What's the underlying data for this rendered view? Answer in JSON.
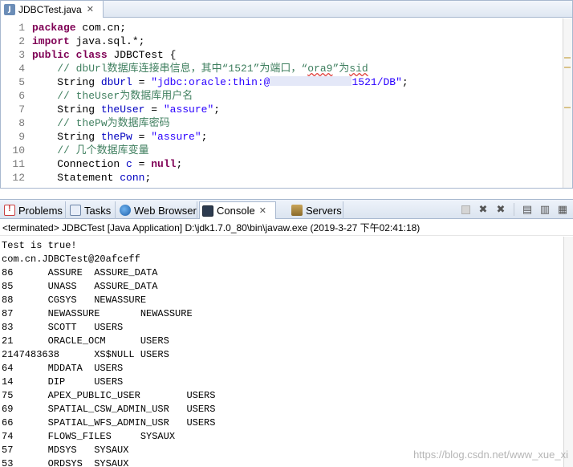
{
  "editor": {
    "tab_title": "JDBCTest.java",
    "lines": [
      {
        "no": "1",
        "tokens": [
          {
            "t": "package",
            "c": "kw"
          },
          {
            "t": " com.cn;",
            "c": ""
          }
        ]
      },
      {
        "no": "2",
        "tokens": [
          {
            "t": "import",
            "c": "kw"
          },
          {
            "t": " java.sql.*;",
            "c": ""
          }
        ]
      },
      {
        "no": "3",
        "tokens": [
          {
            "t": "public",
            "c": "kw"
          },
          {
            "t": " ",
            "c": ""
          },
          {
            "t": "class",
            "c": "kw"
          },
          {
            "t": " JDBCTest {",
            "c": ""
          }
        ]
      },
      {
        "no": "4",
        "tokens": [
          {
            "t": "    // dbUrl数据库连接串信息，其中“1521”为端口，“",
            "c": "cm"
          },
          {
            "t": "ora9",
            "c": "cm squig"
          },
          {
            "t": "”为",
            "c": "cm"
          },
          {
            "t": "sid",
            "c": "cm squig"
          }
        ]
      },
      {
        "no": "5",
        "tokens": [
          {
            "t": "    String ",
            "c": ""
          },
          {
            "t": "dbUrl",
            "c": "fd"
          },
          {
            "t": " = ",
            "c": ""
          },
          {
            "t": "\"jdbc:oracle:thin:@",
            "c": "st"
          },
          {
            "t": "",
            "c": "redact"
          },
          {
            "t": "1521/DB\"",
            "c": "st"
          },
          {
            "t": ";",
            "c": ""
          }
        ]
      },
      {
        "no": "6",
        "tokens": [
          {
            "t": "    // theUser为数据库用户名",
            "c": "cm"
          }
        ]
      },
      {
        "no": "7",
        "tokens": [
          {
            "t": "    String ",
            "c": ""
          },
          {
            "t": "theUser",
            "c": "fd"
          },
          {
            "t": " = ",
            "c": ""
          },
          {
            "t": "\"assure\"",
            "c": "st"
          },
          {
            "t": ";",
            "c": ""
          }
        ]
      },
      {
        "no": "8",
        "tokens": [
          {
            "t": "    // thePw为数据库密码",
            "c": "cm"
          }
        ]
      },
      {
        "no": "9",
        "tokens": [
          {
            "t": "    String ",
            "c": ""
          },
          {
            "t": "thePw",
            "c": "fd"
          },
          {
            "t": " = ",
            "c": ""
          },
          {
            "t": "\"assure\"",
            "c": "st"
          },
          {
            "t": ";",
            "c": ""
          }
        ]
      },
      {
        "no": "10",
        "tokens": [
          {
            "t": "    // 几个数据库变量",
            "c": "cm"
          }
        ]
      },
      {
        "no": "11",
        "tokens": [
          {
            "t": "    Connection ",
            "c": ""
          },
          {
            "t": "c",
            "c": "fd"
          },
          {
            "t": " = ",
            "c": ""
          },
          {
            "t": "null",
            "c": "kw"
          },
          {
            "t": ";",
            "c": ""
          }
        ]
      },
      {
        "no": "12",
        "tokens": [
          {
            "t": "    Statement ",
            "c": ""
          },
          {
            "t": "conn",
            "c": "fd"
          },
          {
            "t": ";",
            "c": ""
          }
        ]
      }
    ]
  },
  "view_tabs": [
    {
      "label": "Problems",
      "icon": "problems-icon"
    },
    {
      "label": "Tasks",
      "icon": "tasks-icon"
    },
    {
      "label": "Web Browser",
      "icon": "web-browser-icon"
    },
    {
      "label": "Console",
      "icon": "console-icon",
      "active": true
    },
    {
      "label": "Servers",
      "icon": "servers-icon"
    }
  ],
  "console": {
    "status": "<terminated> JDBCTest [Java Application] D:\\jdk1.7.0_80\\bin\\javaw.exe (2019-3-27 下午02:41:18)",
    "output": [
      "Test is true!",
      "com.cn.JDBCTest@20afceff",
      "86      ASSURE  ASSURE_DATA",
      "85      UNASS   ASSURE_DATA",
      "88      CGSYS   NEWASSURE",
      "87      NEWASSURE       NEWASSURE",
      "83      SCOTT   USERS",
      "21      ORACLE_OCM      USERS",
      "2147483638      XS$NULL USERS",
      "64      MDDATA  USERS",
      "14      DIP     USERS",
      "75      APEX_PUBLIC_USER        USERS",
      "69      SPATIAL_CSW_ADMIN_USR   USERS",
      "66      SPATIAL_WFS_ADMIN_USR   USERS",
      "74      FLOWS_FILES     SYSAUX",
      "57      MDSYS   SYSAUX",
      "53      ORDSYS  SYSAUX"
    ]
  },
  "watermark": "https://blog.csdn.net/www_xue_xi"
}
